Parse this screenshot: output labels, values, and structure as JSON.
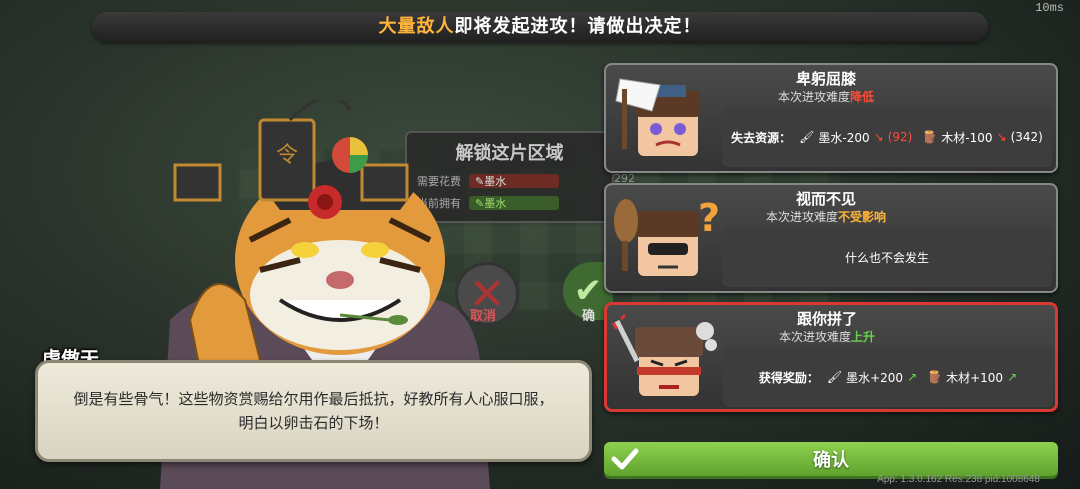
{
  "fps_label": "10ms",
  "banner": {
    "highlight": "大量敌人",
    "rest": "即将发起进攻！请做出决定！"
  },
  "unlock_panel": {
    "title": "解锁这片区域",
    "cost_label": "需要花费",
    "cost_resource": "墨水",
    "owned_label": "当前拥有",
    "owned_resource": "墨水",
    "owned_count": "292",
    "cancel_label": "取消",
    "confirm_label": "确"
  },
  "speaker": {
    "name": "虎傲天",
    "line1": "倒是有些骨气！这些物资赏赐给尔用作最后抵抗，好教所有人心服口服，",
    "line2": "明白以卵击石的下场！"
  },
  "options": [
    {
      "title": "卑躬屈膝",
      "sub_prefix": "本次进攻难度",
      "level": "降低",
      "level_color": "#ff4a3a",
      "detail_label": "失去资源：",
      "res1": "墨水-200",
      "res1_have": "(92)",
      "res2": "木材-100",
      "res2_have": "(342)"
    },
    {
      "title": "视而不见",
      "sub_prefix": "本次进攻难度",
      "level": "不受影响",
      "level_color": "#ffb43a",
      "detail": "什么也不会发生"
    },
    {
      "title": "跟你拼了",
      "sub_prefix": "本次进攻难度",
      "level": "上升",
      "level_color": "#67d34a",
      "detail_label": "获得奖励：",
      "res1": "墨水+200",
      "res2": "木材+100",
      "selected": true
    }
  ],
  "confirm_button": "确认",
  "app_info": "App: 1.3.0.162 Res:238 pid:1008648",
  "icons": [
    "ink-brush-icon",
    "wood-log-icon",
    "down-arrow-icon",
    "up-arrow-icon",
    "checkmark-icon",
    "cross-icon"
  ]
}
